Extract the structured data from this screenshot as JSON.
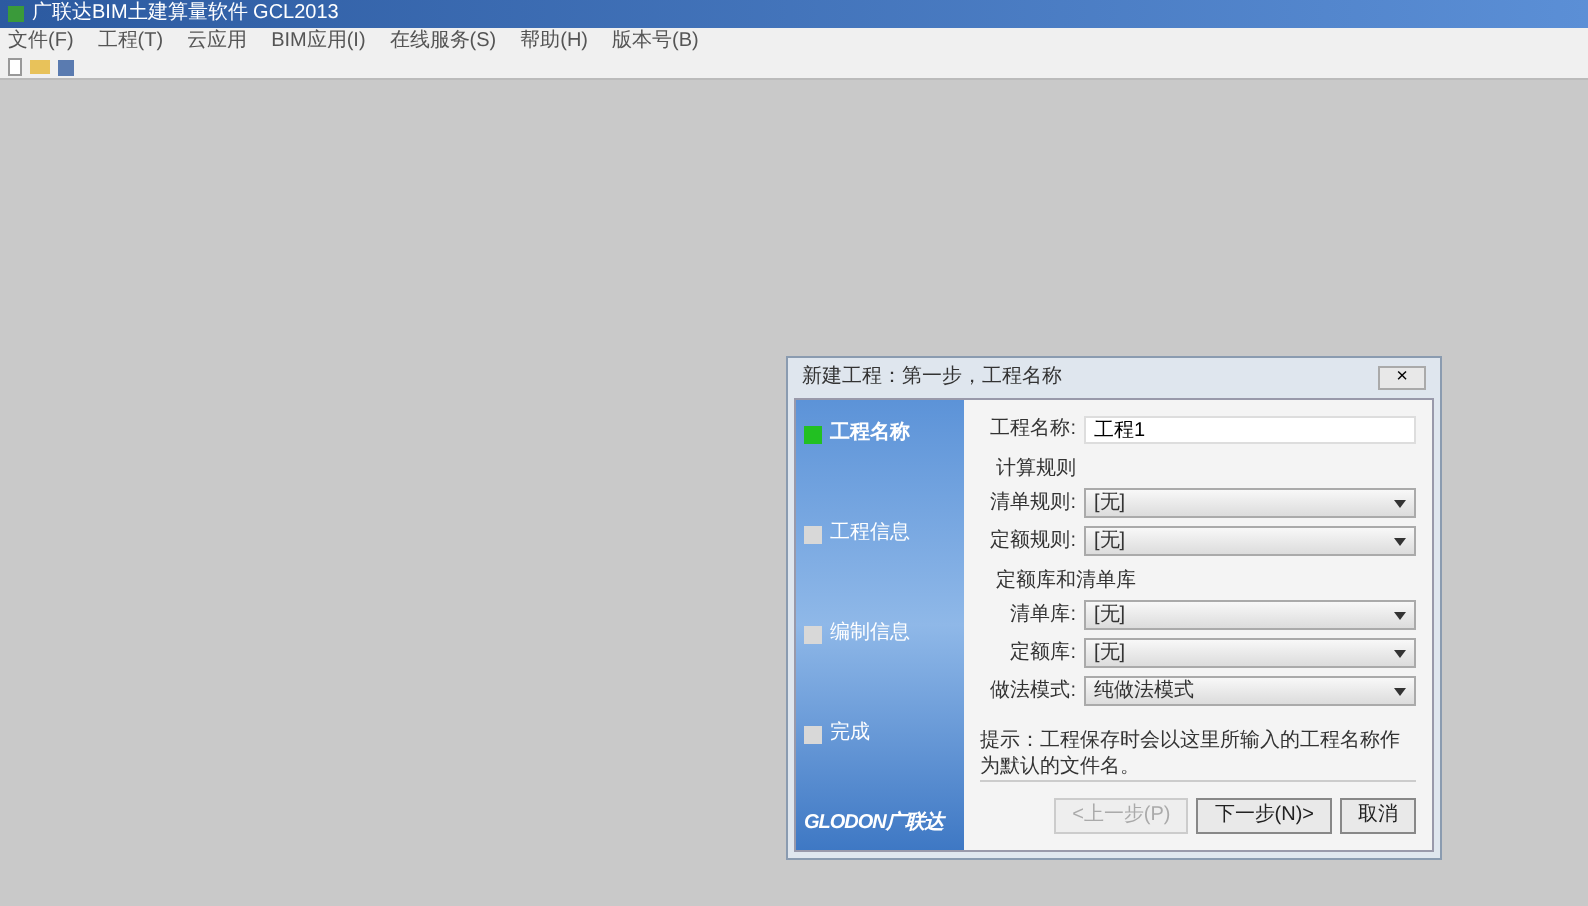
{
  "window": {
    "title": "广联达BIM土建算量软件 GCL2013"
  },
  "menu": [
    "文件(F)",
    "工程(T)",
    "云应用",
    "BIM应用(I)",
    "在线服务(S)",
    "帮助(H)",
    "版本号(B)"
  ],
  "dialog": {
    "title": "新建工程：第一步，工程名称",
    "close": "×",
    "steps": [
      {
        "label": "工程名称",
        "selected": true
      },
      {
        "label": "工程信息",
        "selected": false
      },
      {
        "label": "编制信息",
        "selected": false
      },
      {
        "label": "完成",
        "selected": false
      }
    ],
    "logo": "GLODON广联达",
    "fields": [
      {
        "kind": "text",
        "label": "工程名称:",
        "value": "工程1"
      },
      {
        "kind": "heading",
        "label": "计算规则"
      },
      {
        "kind": "select",
        "label": "清单规则:",
        "value": "[无]"
      },
      {
        "kind": "select",
        "label": "定额规则:",
        "value": "[无]"
      },
      {
        "kind": "heading",
        "label": "定额库和清单库"
      },
      {
        "kind": "select",
        "label": "清单库:",
        "value": "[无]"
      },
      {
        "kind": "select",
        "label": "定额库:",
        "value": "[无]"
      },
      {
        "kind": "select",
        "label": "做法模式:",
        "value": "纯做法模式"
      }
    ],
    "hint": "提示：工程保存时会以这里所输入的工程名称作为默认的文件名。",
    "buttons": [
      {
        "label": "<上一步(P)",
        "disabled": true
      },
      {
        "label": "下一步(N)>",
        "disabled": false
      },
      {
        "label": "取消",
        "disabled": false
      }
    ]
  }
}
